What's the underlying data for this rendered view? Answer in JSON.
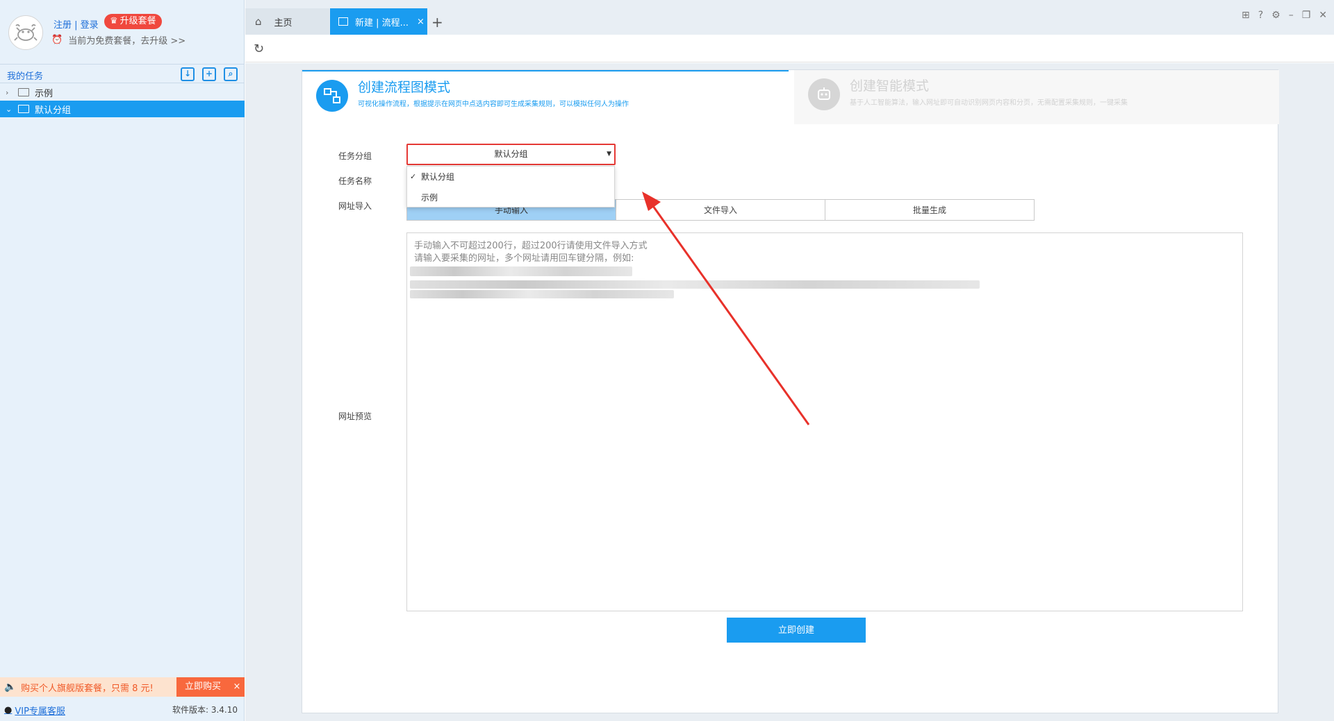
{
  "sidebar": {
    "login_label": "注册 | 登录",
    "upgrade_label": "升级套餐",
    "plan_text": "当前为免费套餐，去升级 >>",
    "tasks_title": "我的任务",
    "tree": [
      {
        "label": "示例",
        "selected": false
      },
      {
        "label": "默认分组",
        "selected": true
      }
    ],
    "promo_text": "购买个人旗舰版套餐，只需 8 元!",
    "promo_buy": "立即购买",
    "promo_close": "×",
    "vip_link": "VIP专属客服",
    "version": "软件版本: 3.4.10"
  },
  "tabs": {
    "home_label": "主页",
    "new_label": "新建 | 流程...",
    "new_close": "×",
    "add": "+"
  },
  "modes": {
    "flow_title": "创建流程图模式",
    "flow_desc": "可视化操作流程，根据提示在网页中点选内容即可生成采集规则，可以模拟任何人为操作",
    "smart_title": "创建智能模式",
    "smart_desc": "基于人工智能算法，输入网址即可自动识别网页内容和分页，无需配置采集规则，一键采集"
  },
  "form": {
    "group_label": "任务分组",
    "group_value": "默认分组",
    "group_options": [
      "默认分组",
      "示例"
    ],
    "name_label": "任务名称",
    "url_import_label": "网址导入",
    "url_tabs": [
      "手动输入",
      "文件导入",
      "批量生成"
    ],
    "url_preview_label": "网址预览",
    "url_placeholder_line1": "手动输入不可超过200行，超过200行请使用文件导入方式",
    "url_placeholder_line2": "请输入要采集的网址，多个网址请用回车键分隔，例如:",
    "create_button": "立即创建"
  },
  "colors": {
    "accent": "#1a9cf0",
    "highlight_border": "#e53935",
    "promo": "#f05a28"
  }
}
